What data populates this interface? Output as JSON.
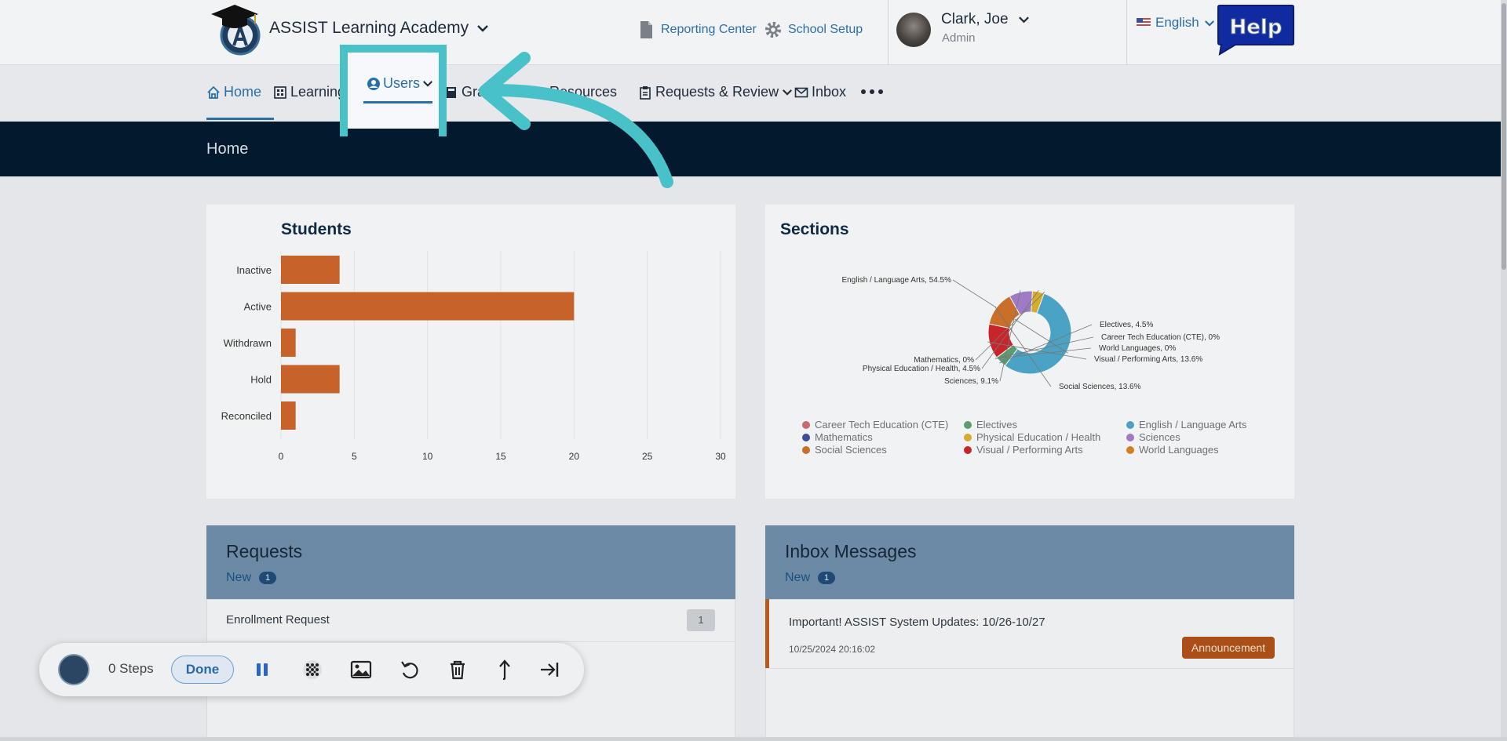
{
  "header": {
    "school_name": "ASSIST Learning Academy",
    "links": [
      "Reporting Center",
      "School Setup"
    ],
    "user_name": "Clark, Joe",
    "user_role": "Admin",
    "language": "English",
    "help_label": "Help"
  },
  "nav": {
    "items": [
      {
        "label": "Home",
        "icon": "home-icon",
        "active": true
      },
      {
        "label": "Learning",
        "icon": "grid-icon",
        "dropdown": true
      },
      {
        "label": "Users",
        "icon": "user-circle-icon",
        "dropdown": true
      },
      {
        "label": "Gra",
        "icon": "book-icon"
      },
      {
        "label": "Resources",
        "icon": "book-icon"
      },
      {
        "label": "Requests & Review",
        "icon": "clipboard-icon",
        "dropdown": true
      },
      {
        "label": "Inbox",
        "icon": "mail-icon"
      }
    ],
    "more": "more-icon"
  },
  "page": {
    "title": "Home"
  },
  "students": {
    "title": "Students"
  },
  "sections": {
    "title": "Sections",
    "slice_labels": [
      "English / Language Arts, 54.5%",
      "Electives, 4.5%",
      "Career Tech Education (CTE), 0%",
      "World Languages, 0%",
      "Visual / Performing Arts, 13.6%",
      "Social Sciences, 13.6%",
      "Sciences, 9.1%",
      "Physical Education / Health, 4.5%",
      "Mathematics, 0%"
    ],
    "legend": [
      {
        "label": "Career Tech Education (CTE)",
        "color": "#c96a6e"
      },
      {
        "label": "Electives",
        "color": "#5a9d6f"
      },
      {
        "label": "English / Language Arts",
        "color": "#4aa3c4"
      },
      {
        "label": "Mathematics",
        "color": "#3f4b9a"
      },
      {
        "label": "Physical Education / Health",
        "color": "#d3ad2b"
      },
      {
        "label": "Sciences",
        "color": "#9e7bc4"
      },
      {
        "label": "Social Sciences",
        "color": "#c96f2a"
      },
      {
        "label": "Visual / Performing Arts",
        "color": "#c7242c"
      },
      {
        "label": "World Languages",
        "color": "#d67d22"
      }
    ]
  },
  "chart_data": [
    {
      "type": "bar",
      "orientation": "horizontal",
      "title": "Students",
      "categories": [
        "Inactive",
        "Active",
        "Withdrawn",
        "Hold",
        "Reconciled"
      ],
      "values": [
        4,
        20,
        1,
        4,
        1
      ],
      "xlim": [
        0,
        30
      ],
      "xticks": [
        0,
        5,
        10,
        15,
        20,
        25,
        30
      ],
      "color": "#c7622a",
      "grid": true
    },
    {
      "type": "pie",
      "style": "donut",
      "title": "Sections",
      "categories": [
        "English / Language Arts",
        "Electives",
        "Career Tech Education (CTE)",
        "World Languages",
        "Visual / Performing Arts",
        "Social Sciences",
        "Sciences",
        "Physical Education / Health",
        "Mathematics"
      ],
      "values": [
        54.5,
        4.5,
        0,
        0,
        13.6,
        13.6,
        9.1,
        4.5,
        0
      ],
      "colors": [
        "#4aa3c4",
        "#5a9d6f",
        "#c96a6e",
        "#d67d22",
        "#c7242c",
        "#c96f2a",
        "#9e7bc4",
        "#d3ad2b",
        "#3f4b9a"
      ],
      "legend": "bottom"
    }
  ],
  "requests": {
    "title": "Requests",
    "new_label": "New",
    "new_count": "1",
    "rows": [
      {
        "label": "Enrollment Request",
        "count": "1"
      }
    ]
  },
  "inbox": {
    "title": "Inbox Messages",
    "new_label": "New",
    "new_count": "1",
    "messages": [
      {
        "subject": "Important! ASSIST System Updates: 10/26-10/27",
        "date": "10/25/2024 20:16:02",
        "tag": "Announcement"
      }
    ]
  },
  "recorder": {
    "steps": "0 Steps",
    "done": "Done",
    "buttons": [
      "pause-icon",
      "blur-icon",
      "image-icon",
      "undo-icon",
      "trash-icon",
      "upload-icon",
      "skip-to-end-icon"
    ]
  }
}
